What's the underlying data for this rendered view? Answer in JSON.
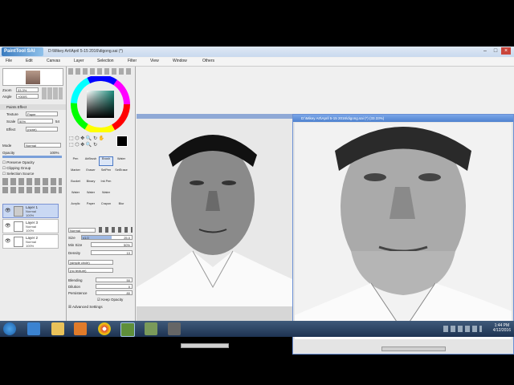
{
  "app": {
    "logo": "PaintTool SAI",
    "title": "D:\\Mikey Art\\April 5-15 2016\\digong.sai (*)"
  },
  "menu": [
    "File",
    "Edit",
    "Canvas",
    "Layer",
    "Selection",
    "Filter",
    "View",
    "Window",
    "Others"
  ],
  "nav": {
    "zoom_label": "Zoom",
    "zoom_value": "33.3%",
    "angle_label": "Angle",
    "angle_value": "+000S"
  },
  "paint_effect": {
    "header": "Paints Effect",
    "texture_label": "Texture",
    "texture_value": "Paper",
    "scale_label": "Scale",
    "scale_value": "50%",
    "scale_num": "54",
    "effect_label": "Effect",
    "effect_value": "(none)"
  },
  "layer_props": {
    "mode_label": "Mode",
    "mode_value": "Normal",
    "opacity_label": "Opacity",
    "opacity_value": "100%",
    "preserve": "Preserve Opacity",
    "clipping": "Clipping Group",
    "selection_source": "Selection Source"
  },
  "layers": [
    {
      "name": "Layer 1",
      "mode": "Normal",
      "opacity": "100%"
    },
    {
      "name": "Layer 3",
      "mode": "Normal",
      "opacity": "100%"
    },
    {
      "name": "Layer 2",
      "mode": "Normal",
      "opacity": "100%"
    }
  ],
  "brushes": [
    [
      "Pen",
      "AirBrush",
      "Brush",
      "Water"
    ],
    [
      "Marker",
      "Eraser",
      "SelPen",
      "SelErase"
    ],
    [
      "Bucket",
      "Binary",
      "Ink Pen",
      ""
    ],
    [
      "Water",
      "Water",
      "Water",
      ""
    ],
    [
      "Acrylic",
      "Paper",
      "Crayon",
      "Blur"
    ]
  ],
  "brush_settings": {
    "mode_value": "Normal",
    "size_label": "Size",
    "size_mult": "x1.0",
    "size_value": "25.0",
    "min_size_label": "Min Size",
    "min_size_value": "50%",
    "density_label": "Density",
    "density_value": "10",
    "shape": "(simple circle)",
    "texture": "(no texture)",
    "blending_label": "Blending",
    "blending_value": "50",
    "dilution_label": "Dilution",
    "dilution_value": "0",
    "persistence_label": "Persistence",
    "persistence_value": "80",
    "keep_opacity": "Keep Opacity",
    "advanced": "Advanced Settings"
  },
  "canvas2": {
    "title": "D:\\Mikey Art\\April 5-15 2016\\digong.sai (*) (33.33%)"
  },
  "taskbar": {
    "time": "1:44 PM",
    "date": "4/12/2016"
  },
  "colors": {
    "selected_layer": "#c9d8f3",
    "title_blue": "#4f82cf"
  }
}
